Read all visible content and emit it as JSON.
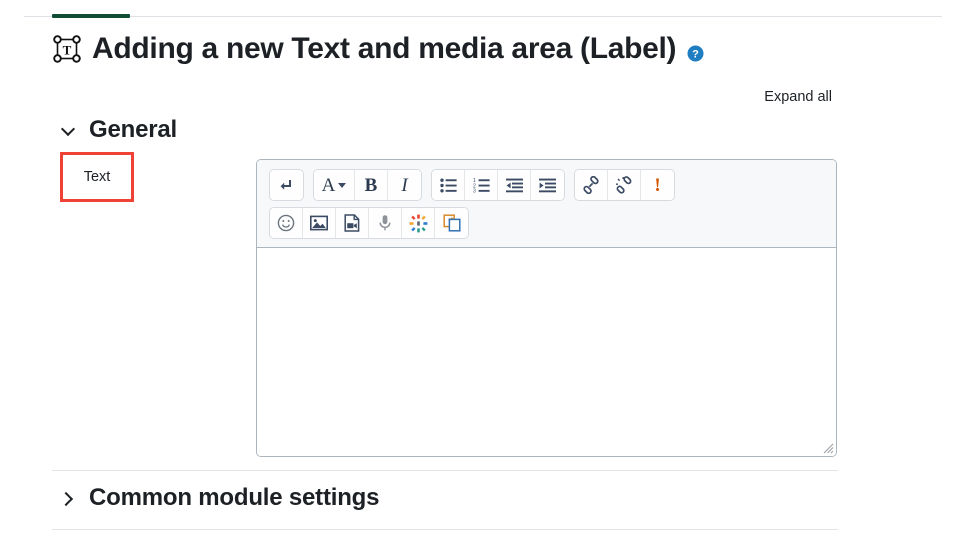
{
  "tabstrip": {
    "active_tab_color": "#0f4d35"
  },
  "header": {
    "icon": "text-and-media-area-icon",
    "title": "Adding a new Text and media area (Label)",
    "help_icon": "help-circle-icon",
    "help_label": "Help with Text and media area"
  },
  "toolbar_links": {
    "expand_all": "Expand all"
  },
  "sections": [
    {
      "id": "general",
      "title": "General",
      "state": "expanded",
      "chevron": "chevron-down-icon"
    },
    {
      "id": "common-module-settings",
      "title": "Common module settings",
      "state": "collapsed",
      "chevron": "chevron-right-icon"
    }
  ],
  "fields": {
    "text": {
      "label": "Text",
      "value": "",
      "highlight_color": "#ef4136"
    }
  },
  "editor": {
    "toolbar_rows": [
      {
        "groups": [
          {
            "buttons": [
              {
                "name": "line-break-icon",
                "title": "Insert line break",
                "glyph": "arrow-down-hook"
              }
            ]
          },
          {
            "buttons": [
              {
                "name": "text-style-icon",
                "title": "Styles",
                "glyph": "A-caret"
              },
              {
                "name": "bold-icon",
                "title": "Bold",
                "glyph": "B"
              },
              {
                "name": "italic-icon",
                "title": "Italic",
                "glyph": "I"
              }
            ]
          },
          {
            "buttons": [
              {
                "name": "bulleted-list-icon",
                "title": "Bulleted list",
                "glyph": "ul"
              },
              {
                "name": "numbered-list-icon",
                "title": "Numbered list",
                "glyph": "ol"
              },
              {
                "name": "decrease-indent-icon",
                "title": "Decrease indent",
                "glyph": "outdent"
              },
              {
                "name": "increase-indent-icon",
                "title": "Increase indent",
                "glyph": "indent"
              }
            ]
          },
          {
            "buttons": [
              {
                "name": "link-icon",
                "title": "Link",
                "glyph": "link"
              },
              {
                "name": "unlink-icon",
                "title": "Unlink",
                "glyph": "unlink"
              },
              {
                "name": "accessibility-checker-icon",
                "title": "Accessibility checker",
                "glyph": "!"
              }
            ]
          }
        ]
      },
      {
        "groups": [
          {
            "buttons": [
              {
                "name": "emoji-icon",
                "title": "Emoji picker",
                "glyph": "smiley"
              },
              {
                "name": "insert-image-icon",
                "title": "Insert or edit image",
                "glyph": "image"
              },
              {
                "name": "insert-media-icon",
                "title": "Insert or edit an audio/video file",
                "glyph": "media-file"
              },
              {
                "name": "record-audio-icon",
                "title": "Record audio",
                "glyph": "microphone"
              },
              {
                "name": "h5p-icon",
                "title": "Insert H5P",
                "glyph": "h5p-star"
              },
              {
                "name": "paste-special-icon",
                "title": "Manage files",
                "glyph": "copy-docs"
              }
            ]
          }
        ]
      }
    ],
    "content": "",
    "resize_handle": "resize-grip-icon"
  }
}
